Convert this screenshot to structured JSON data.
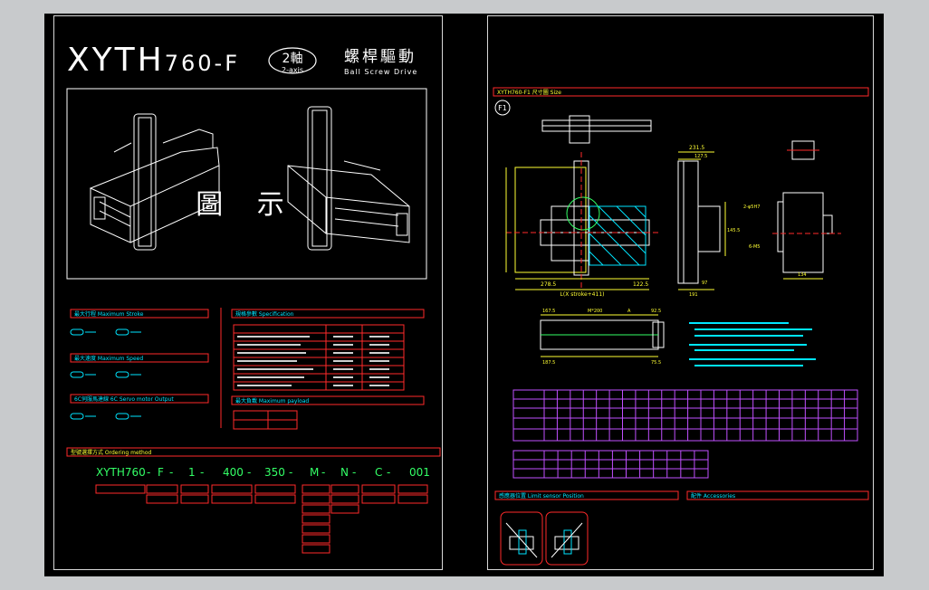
{
  "title": {
    "model_big": "XYTH",
    "model_small": "760-F",
    "axis_badge": "2軸",
    "axis_sub": "2-axis",
    "drive_cn": "螺桿驅動",
    "drive_en": "Ball Screw Drive"
  },
  "figure_label": "圖 示",
  "sections": {
    "stroke": "最大行程 Maximum Stroke",
    "speed": "最大速度 Maximum Speed",
    "cable": "6C伺服馬達線 6C Servo motor Output",
    "spec": "規格參數 Specification",
    "payload": "最大負載 Maximum payload",
    "ordering": "型號選擇方式 Ordering method",
    "size": "XYTH760-F1 尺寸圖 Size",
    "limit": "感應器位置 Limit sensor Position",
    "accessories": "配件 Accessories"
  },
  "ordering_code": [
    "XYTH760",
    "F",
    "1",
    "400",
    "350",
    "M",
    "N",
    "C",
    "001"
  ],
  "dimensions": {
    "d1": "231.5",
    "d2": "127.5",
    "d3": "145.5",
    "d4": "97",
    "d5": "191",
    "d6": "278.5",
    "d7": "122.5",
    "d8": "L(X stroke+411)",
    "d9": "167.5",
    "d10": "M*200",
    "d11": "A",
    "d12": "92.5",
    "d13": "187.5",
    "d14": "75.5",
    "d15": "134",
    "d16": "2-φ5H7",
    "d17": "6-M5"
  },
  "figure_number": "F1",
  "colors": {
    "red": "#ff2a2a",
    "cyan": "#00e5ff",
    "yellow": "#ffff33",
    "green": "#33ff66",
    "magenta": "#c050ff",
    "white": "#f0f0f0"
  }
}
